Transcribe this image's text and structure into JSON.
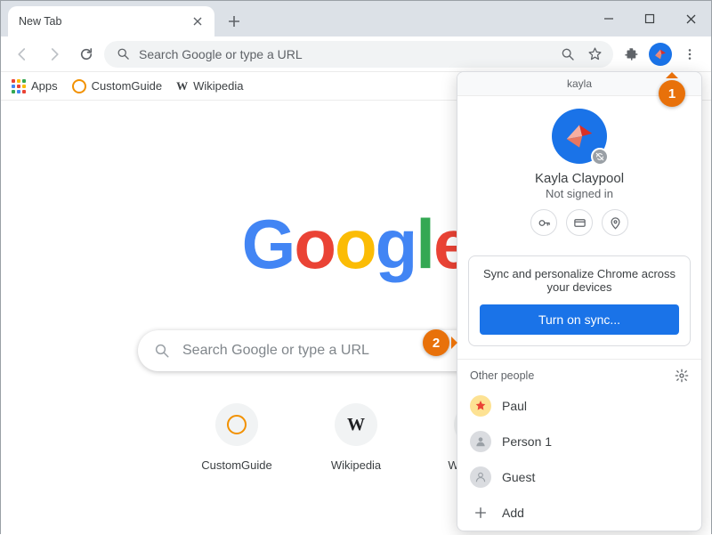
{
  "tab": {
    "title": "New Tab"
  },
  "omnibox": {
    "placeholder": "Search Google or type a URL"
  },
  "bookmarks": {
    "apps": "Apps",
    "customguide": "CustomGuide",
    "wikipedia": "Wikipedia"
  },
  "ntp": {
    "search_placeholder": "Search Google or type a URL",
    "shortcuts": [
      {
        "label": "CustomGuide"
      },
      {
        "label": "Wikipedia"
      },
      {
        "label": "Web Store"
      }
    ]
  },
  "profile": {
    "header": "kayla",
    "name": "Kayla Claypool",
    "status": "Not signed in",
    "sync_message": "Sync and personalize Chrome across your devices",
    "sync_button": "Turn on sync...",
    "other_header": "Other people",
    "people": [
      {
        "name": "Paul"
      },
      {
        "name": "Person 1"
      },
      {
        "name": "Guest"
      },
      {
        "name": "Add"
      }
    ]
  },
  "callouts": {
    "one": "1",
    "two": "2"
  }
}
